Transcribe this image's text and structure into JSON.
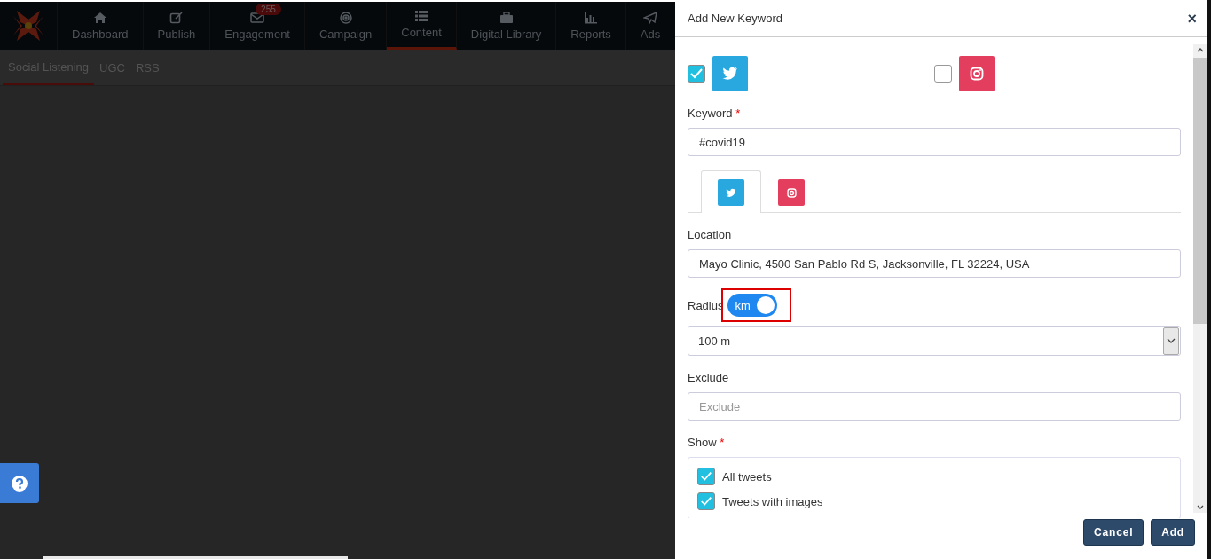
{
  "nav": {
    "items": [
      {
        "kind": "home",
        "label": "Dashboard",
        "selected": false
      },
      {
        "kind": "edit",
        "label": "Publish",
        "selected": false
      },
      {
        "kind": "mail",
        "label": "Engagement",
        "selected": false,
        "badge": "255"
      },
      {
        "kind": "target",
        "label": "Campaign",
        "selected": false
      },
      {
        "kind": "list",
        "label": "Content",
        "selected": true
      },
      {
        "kind": "briefcase",
        "label": "Digital Library",
        "selected": false
      },
      {
        "kind": "chart",
        "label": "Reports",
        "selected": false
      },
      {
        "kind": "plane",
        "label": "Ads",
        "selected": false
      }
    ]
  },
  "subtabs": [
    {
      "label": "Social Listening",
      "selected": true
    },
    {
      "label": "UGC",
      "selected": false
    },
    {
      "label": "RSS",
      "selected": false
    }
  ],
  "modal": {
    "title": "Add New Keyword",
    "close": "×",
    "platforms": [
      {
        "kind": "twitter",
        "checked": true
      },
      {
        "kind": "instagram",
        "checked": false
      }
    ],
    "keyword": {
      "label": "Keyword",
      "required_mark": "*",
      "value": "#covid19"
    },
    "platform_tabs": [
      {
        "kind": "twitter",
        "selected": true
      },
      {
        "kind": "instagram",
        "selected": false
      }
    ],
    "location": {
      "label": "Location",
      "value": "Mayo Clinic, 4500 San Pablo Rd S, Jacksonville, FL 32224, USA"
    },
    "radius": {
      "label": "Radius",
      "toggle": {
        "label": "km",
        "on": true
      },
      "value": "100 m"
    },
    "exclude": {
      "label": "Exclude",
      "placeholder": "Exclude"
    },
    "show": {
      "label": "Show",
      "required_mark": "*",
      "options": [
        {
          "label": "All tweets",
          "checked": true
        },
        {
          "label": "Tweets with images",
          "checked": true
        }
      ]
    },
    "buttons": [
      {
        "label": "Cancel"
      },
      {
        "label": "Add"
      }
    ]
  }
}
